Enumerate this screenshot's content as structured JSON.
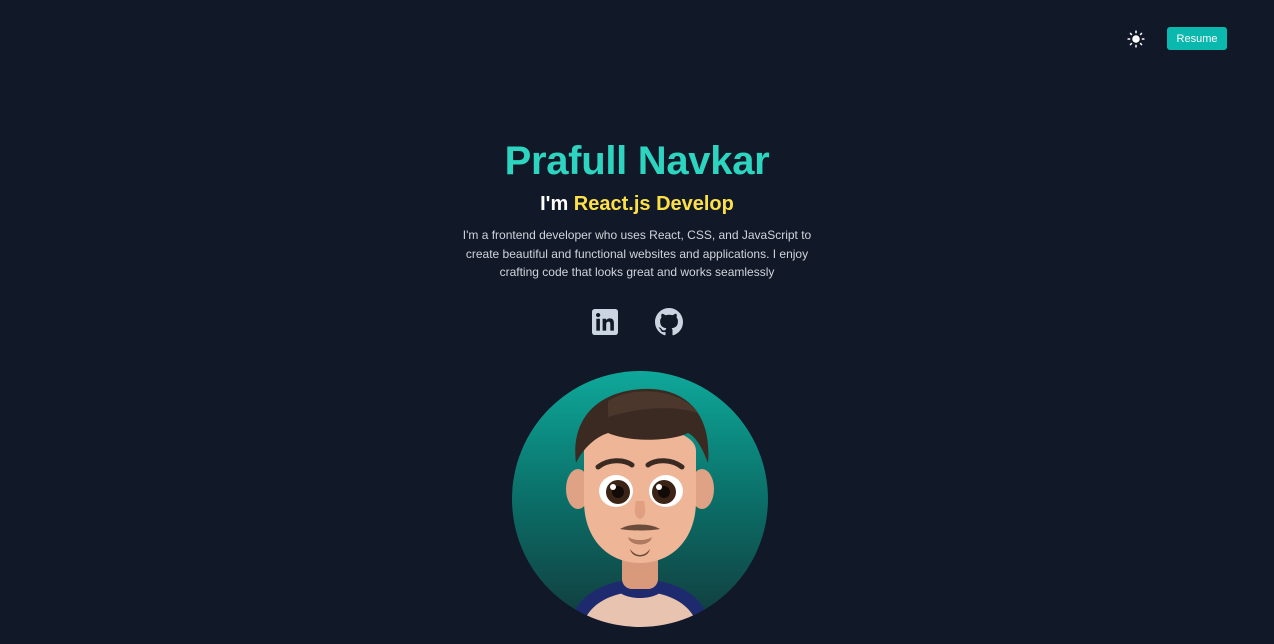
{
  "header": {
    "theme_toggle_icon": "sun-icon",
    "resume_label": "Resume"
  },
  "hero": {
    "name": "Prafull Navkar",
    "role_prefix": "I'm",
    "role_highlight": "React.js Develop",
    "bio": "I'm a frontend developer who uses React, CSS, and JavaScript to create beautiful and functional websites and applications. I enjoy crafting code that looks great and works seamlessly"
  },
  "socials": [
    {
      "icon": "linkedin-icon"
    },
    {
      "icon": "github-icon"
    }
  ],
  "colors": {
    "background": "#111827",
    "accent": "#2dd4bf",
    "highlight": "#fde047",
    "button": "#0bb8ad"
  }
}
